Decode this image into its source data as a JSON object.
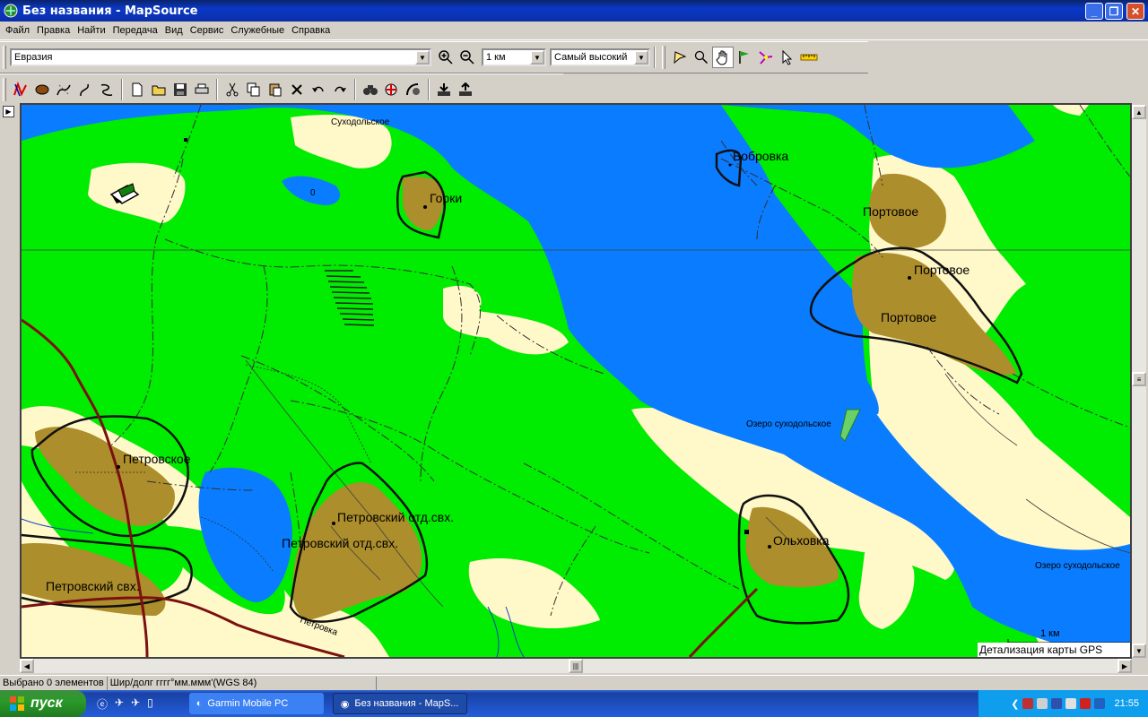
{
  "window": {
    "title": "Без названия - MapSource",
    "minimize_label": "_",
    "maximize_label": "❐",
    "close_label": "✕"
  },
  "menu": [
    "Файл",
    "Правка",
    "Найти",
    "Передача",
    "Вид",
    "Сервис",
    "Служебные",
    "Справка"
  ],
  "toolbar1": {
    "map_product": "Евразия",
    "scale": "1 км",
    "detail": "Самый высокий"
  },
  "map": {
    "labels": {
      "sukhodolskoe_top": "Суходольское",
      "bobrovka": "Бобровка",
      "gorki": "Горки",
      "portovoe1": "Портовое",
      "portovoe2": "Портовое",
      "portovoe3": "Портовое",
      "lake_label1": "Озеро суходольское",
      "lake_label2": "Озеро суходольское",
      "petrovskoe": "Петровское",
      "petrovsky_otd1": "Петровский отд.свх.",
      "petrovsky_otd2": "Петровский отд.свх.",
      "petrovsky_svh": "Петровский свх.",
      "olkhovka": "Ольховка",
      "petrovka_road": "Петровка",
      "pond_zero": "0"
    },
    "scale_label": "1 км",
    "detail_caption": "Детализация карты GPS"
  },
  "status": {
    "selected": "Выбрано 0 элементов",
    "coords_format": "Шир/долг гггг°мм.ммм'(WGS 84)"
  },
  "taskbar": {
    "start_label": "пуск",
    "tasks": [
      {
        "label": "Garmin Mobile PC"
      },
      {
        "label": "Без названия - MapS..."
      }
    ],
    "clock": "21:55"
  },
  "colors": {
    "land": "#00ec00",
    "water": "#0a7cff",
    "settlement": "#ad8e2c",
    "open": "#fff8c8"
  }
}
